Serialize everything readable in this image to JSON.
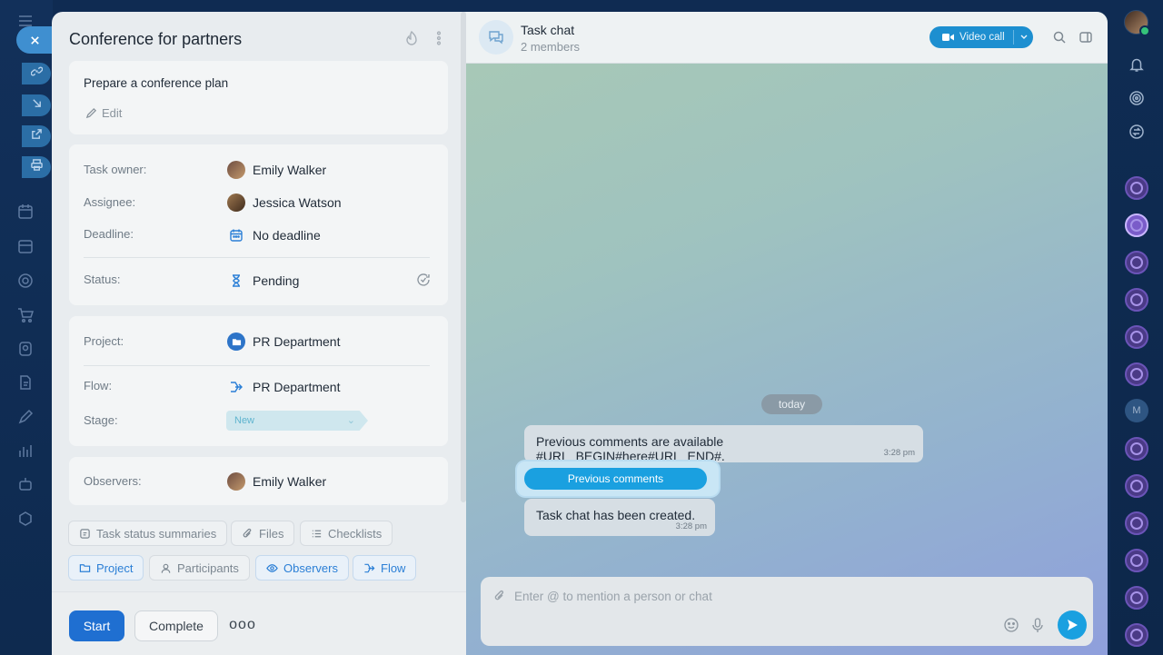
{
  "task": {
    "title": "Conference for partners",
    "description": "Prepare a conference plan",
    "edit_label": "Edit",
    "fields": {
      "owner_label": "Task owner:",
      "owner_value": "Emily Walker",
      "assignee_label": "Assignee:",
      "assignee_value": "Jessica Watson",
      "deadline_label": "Deadline:",
      "deadline_value": "No deadline",
      "status_label": "Status:",
      "status_value": "Pending",
      "project_label": "Project:",
      "project_value": "PR Department",
      "flow_label": "Flow:",
      "flow_value": "PR Department",
      "stage_label": "Stage:",
      "stage_value": "New",
      "observers_label": "Observers:",
      "observers_value": "Emily Walker"
    },
    "chips_row1": [
      "Task status summaries",
      "Files",
      "Checklists"
    ],
    "chips_row2": [
      "Project",
      "Participants",
      "Observers",
      "Flow"
    ],
    "footer": {
      "start_label": "Start",
      "complete_label": "Complete",
      "more_label": "ooo"
    }
  },
  "chat": {
    "title": "Task chat",
    "subtitle": "2 members",
    "video_call_label": "Video call",
    "date_divider": "today",
    "messages": [
      {
        "text": "Previous comments are available #URL_BEGIN#here#URL_END#.",
        "time": "3:28 pm"
      },
      {
        "text": "Task chat has been created.",
        "time": "3:28 pm"
      }
    ],
    "previous_comments_button": "Previous comments",
    "input_placeholder": "Enter @ to mention a person or chat"
  },
  "right_rail": {
    "letter_avatar": "M"
  },
  "colors": {
    "accent": "#1aa0e0",
    "primary_button": "#1f6fd1",
    "chip_blue": "#2b7fd6",
    "rail_bg": "#0f2b52"
  }
}
